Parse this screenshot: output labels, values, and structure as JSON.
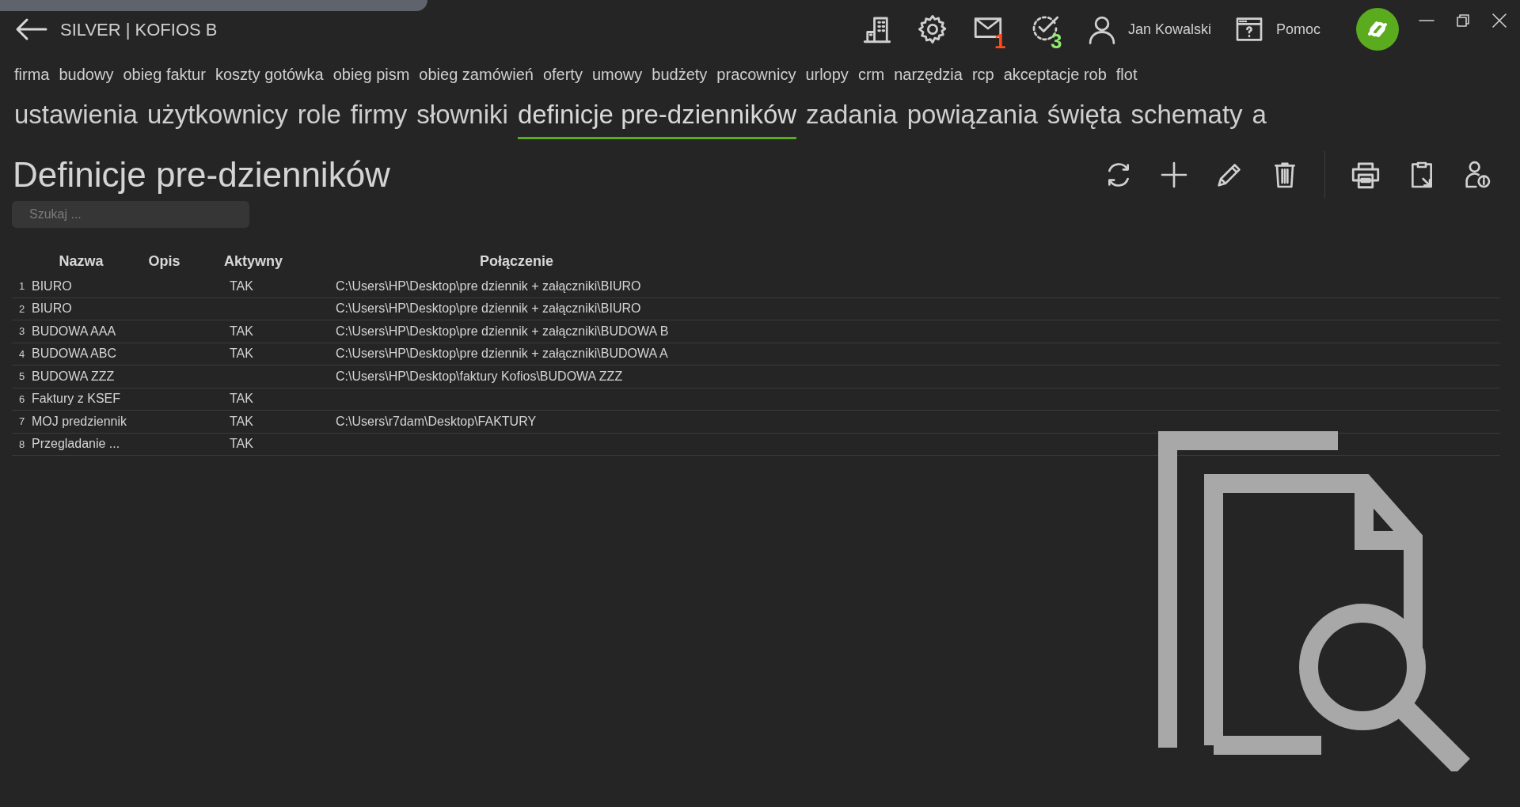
{
  "window": {
    "title": "SILVER | KOFIOS B"
  },
  "header": {
    "user": "Jan Kowalski",
    "help": "Pomoc",
    "mail_count": "1",
    "tasks_count": "3"
  },
  "modules": [
    {
      "label": "firma",
      "selected": false
    },
    {
      "label": "budowy",
      "selected": false
    },
    {
      "label": "obieg faktur",
      "selected": false
    },
    {
      "label": "koszty gotówka",
      "selected": false
    },
    {
      "label": "obieg pism",
      "selected": false
    },
    {
      "label": "obieg zamówień",
      "selected": false
    },
    {
      "label": "oferty",
      "selected": false
    },
    {
      "label": "umowy",
      "selected": false
    },
    {
      "label": "budżety",
      "selected": false
    },
    {
      "label": "pracownicy",
      "selected": false
    },
    {
      "label": "urlopy",
      "selected": false
    },
    {
      "label": "crm",
      "selected": false
    },
    {
      "label": "narzędzia",
      "selected": false
    },
    {
      "label": "rcp",
      "selected": false
    },
    {
      "label": "akceptacje rob",
      "selected": false
    },
    {
      "label": "flot",
      "selected": false
    }
  ],
  "tabs": [
    {
      "label": "ustawienia",
      "selected": false
    },
    {
      "label": "użytkownicy",
      "selected": false
    },
    {
      "label": "role",
      "selected": false
    },
    {
      "label": "firmy",
      "selected": false
    },
    {
      "label": "słowniki",
      "selected": false
    },
    {
      "label": "definicje pre-dzienników",
      "selected": true
    },
    {
      "label": "zadania",
      "selected": false
    },
    {
      "label": "powiązania",
      "selected": false
    },
    {
      "label": "święta",
      "selected": false
    },
    {
      "label": "schematy",
      "selected": false
    },
    {
      "label": "a",
      "selected": false
    }
  ],
  "page_title": "Definicje pre-dzienników",
  "search": {
    "placeholder": "Szukaj ..."
  },
  "table": {
    "columns": [
      "Nazwa",
      "Opis",
      "Aktywny",
      "Połączenie"
    ],
    "rows": [
      {
        "number": "1",
        "name": "BIURO",
        "active": "TAK",
        "connection": "C:\\Users\\HP\\Desktop\\pre dziennik + załączniki\\BIURO"
      },
      {
        "number": "2",
        "name": "BIURO",
        "connection": "C:\\Users\\HP\\Desktop\\pre dziennik + załączniki\\BIURO"
      },
      {
        "number": "3",
        "name": "BUDOWA AAA",
        "active": "TAK",
        "connection": "C:\\Users\\HP\\Desktop\\pre dziennik + załączniki\\BUDOWA B"
      },
      {
        "number": "4",
        "name": "BUDOWA ABC",
        "active": "TAK",
        "connection": "C:\\Users\\HP\\Desktop\\pre dziennik + załączniki\\BUDOWA A"
      },
      {
        "number": "5",
        "name": "BUDOWA ZZZ",
        "connection": "C:\\Users\\HP\\Desktop\\faktury Kofios\\BUDOWA ZZZ"
      },
      {
        "number": "6",
        "name": "Faktury z KSEF",
        "active": "TAK"
      },
      {
        "number": "7",
        "name": "MOJ predziennik",
        "active": "TAK",
        "connection": "C:\\Users\\r7dam\\Desktop\\FAKTURY"
      },
      {
        "number": "8",
        "name": "Przegladanie ...",
        "active": "TAK"
      }
    ]
  }
}
